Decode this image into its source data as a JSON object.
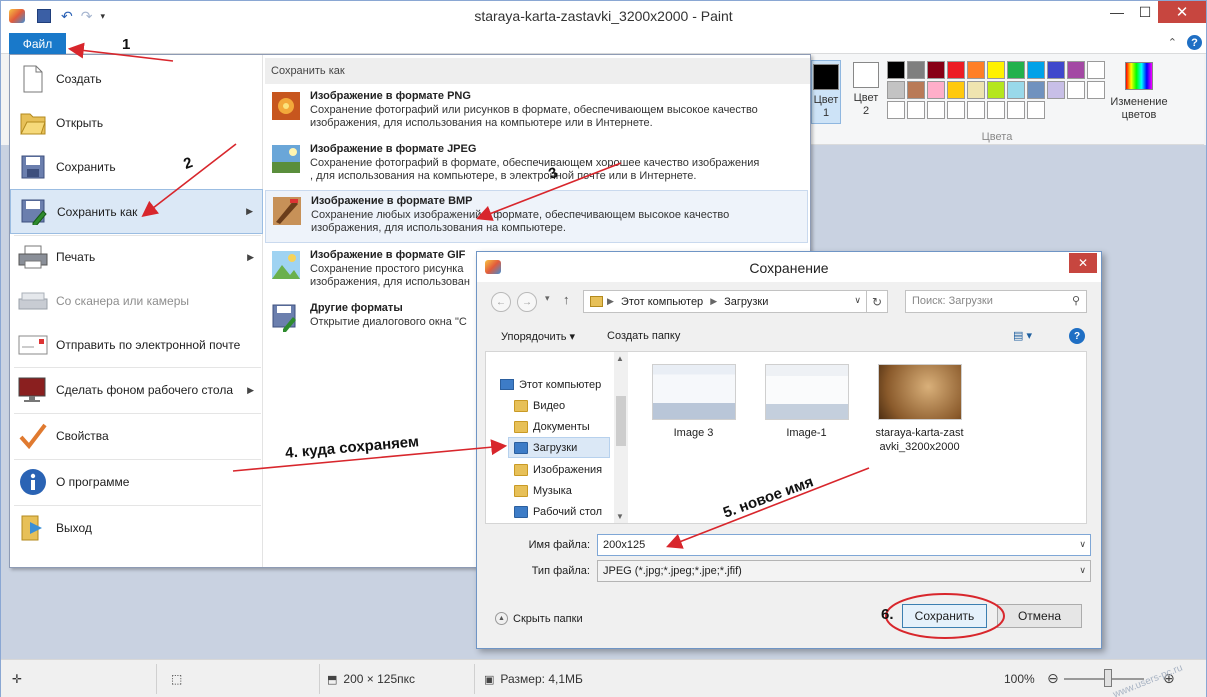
{
  "window": {
    "title": "staraya-karta-zastavki_3200x2000 - Paint",
    "close": "✕",
    "max": "☐",
    "min": "—"
  },
  "file_tab": "Файл",
  "ribbon": {
    "color1": "Цвет 1",
    "color1_line1": "Цвет",
    "color1_line2": "1",
    "color2_line1": "Цвет",
    "color2_line2": "2",
    "edit_line1": "Изменение",
    "edit_line2": "цветов",
    "group": "Цвета",
    "palette": [
      "#000000",
      "#7f7f7f",
      "#880015",
      "#ed1c24",
      "#ff7f27",
      "#fff200",
      "#22b14c",
      "#00a2e8",
      "#3f48cc",
      "#a349a4",
      "#ffffff",
      "#c3c3c3",
      "#b97a57",
      "#ffaec9",
      "#ffc90e",
      "#efe4b0",
      "#b5e61d",
      "#99d9ea",
      "#7092be",
      "#c8bfe7",
      "#ffffff",
      "#ffffff",
      "#ffffff",
      "#ffffff",
      "#ffffff",
      "#ffffff",
      "#ffffff",
      "#ffffff",
      "#ffffff",
      "#ffffff"
    ],
    "help": "?"
  },
  "menu": {
    "items": [
      {
        "label": "Создать"
      },
      {
        "label": "Открыть"
      },
      {
        "label": "Сохранить"
      },
      {
        "label": "Сохранить как"
      },
      {
        "label": "Печать"
      },
      {
        "label": "Со сканера или камеры"
      },
      {
        "label": "Отправить по электронной почте"
      },
      {
        "label": "Сделать фоном рабочего стола"
      },
      {
        "label": "Свойства"
      },
      {
        "label": "О программе"
      },
      {
        "label": "Выход"
      }
    ],
    "save_as_header": "Сохранить как",
    "formats": [
      {
        "title": "Изображение в формате PNG",
        "desc1": "Сохранение фотографий или рисунков в формате, обеспечивающем высокое качество",
        "desc2": "изображения, для использования на компьютере или в Интернете."
      },
      {
        "title": "Изображение в формате JPEG",
        "desc1": "Сохранение фотографий в формате, обеспечивающем хорошее качество изображения",
        "desc2": ", для использования на компьютере, в электронной почте или в Интернете."
      },
      {
        "title": "Изображение в формате BMP",
        "desc1": "Сохранение любых изображений в формате, обеспечивающем высокое качество",
        "desc2": "изображения, для использования на компьютере."
      },
      {
        "title": "Изображение в формате GIF",
        "desc1": "Сохранение простого рисунка",
        "desc2": "изображения, для использован"
      },
      {
        "title": "Другие форматы",
        "desc1": "Открытие диалогового окна \"С",
        "desc2": ""
      }
    ]
  },
  "dialog": {
    "title": "Сохранение",
    "address": [
      "Этот компьютер",
      "Загрузки"
    ],
    "search_placeholder": "Поиск: Загрузки",
    "organize": "Упорядочить ▾",
    "new_folder": "Создать папку",
    "tree": {
      "root": "Этот компьютер",
      "items": [
        "Видео",
        "Документы",
        "Загрузки",
        "Изображения",
        "Музыка",
        "Рабочий стол"
      ]
    },
    "files": [
      {
        "name1": "Image 3",
        "name2": ""
      },
      {
        "name1": "Image-1",
        "name2": ""
      },
      {
        "name1": "staraya-karta-zast",
        "name2": "avki_3200x2000"
      }
    ],
    "filename_label": "Имя файла:",
    "filename_value": "200x125",
    "filetype_label": "Тип файла:",
    "filetype_value": "JPEG (*.jpg;*.jpeg;*.jpe;*.jfif)",
    "hide_folders": "Скрыть папки",
    "save": "Сохранить",
    "cancel": "Отмена"
  },
  "status": {
    "dimensions": "200 × 125пкс",
    "size": "Размер: 4,1МБ",
    "zoom": "100%"
  },
  "annotations": {
    "a1": "1",
    "a2": "2",
    "a3": "3",
    "a4": "4. куда сохраняем",
    "a5": "5. новое имя",
    "a6": "6."
  },
  "watermark": "www.users-pc.ru",
  "accent": "#1979ca",
  "annotation_color": "#d8262c"
}
